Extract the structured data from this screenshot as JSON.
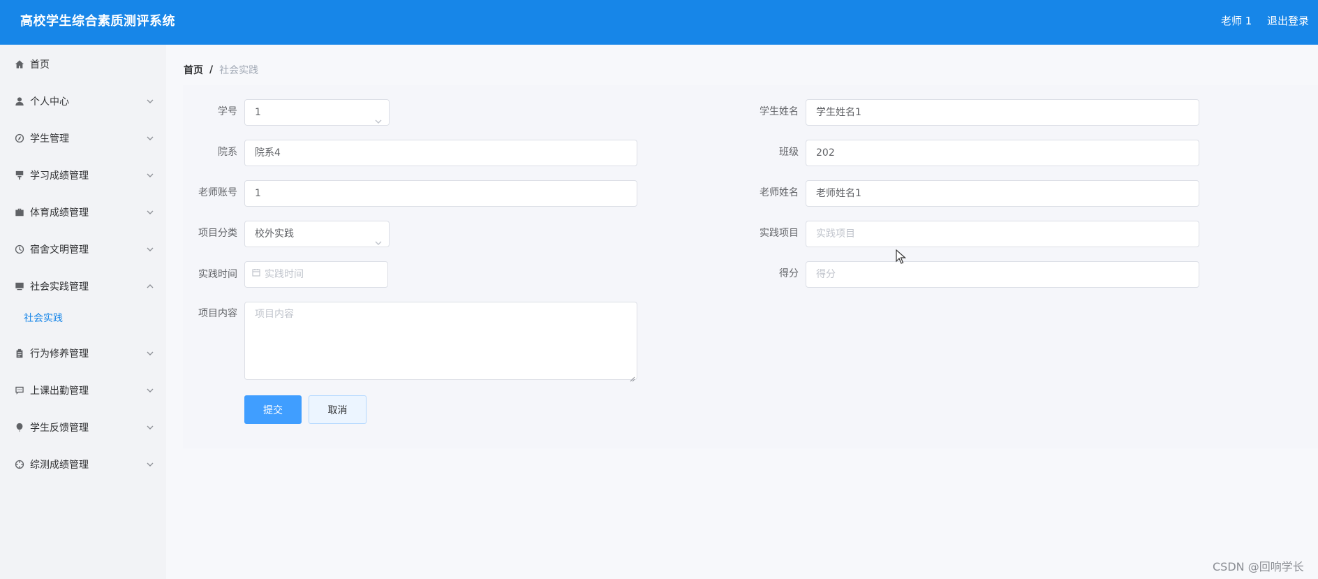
{
  "header": {
    "title": "高校学生综合素质测评系统",
    "user": "老师 1",
    "logout": "退出登录"
  },
  "sidebar": {
    "items": [
      {
        "label": "首页",
        "icon": "home-icon",
        "arrow": false
      },
      {
        "label": "个人中心",
        "icon": "user-icon",
        "arrow": "down"
      },
      {
        "label": "学生管理",
        "icon": "compass-icon",
        "arrow": "down"
      },
      {
        "label": "学习成绩管理",
        "icon": "brush-icon",
        "arrow": "down"
      },
      {
        "label": "体育成绩管理",
        "icon": "briefcase-icon",
        "arrow": "down"
      },
      {
        "label": "宿舍文明管理",
        "icon": "clock-icon",
        "arrow": "down"
      },
      {
        "label": "社会实践管理",
        "icon": "monitor-icon",
        "arrow": "up"
      },
      {
        "label": "行为修养管理",
        "icon": "clipboard-icon",
        "arrow": "down"
      },
      {
        "label": "上课出勤管理",
        "icon": "chat-icon",
        "arrow": "down"
      },
      {
        "label": "学生反馈管理",
        "icon": "balloon-icon",
        "arrow": "down"
      },
      {
        "label": "综测成绩管理",
        "icon": "crosshair-icon",
        "arrow": "down"
      }
    ],
    "subitem": "社会实践"
  },
  "breadcrumb": {
    "home": "首页",
    "separator": "/",
    "current": "社会实践"
  },
  "form": {
    "student_id": {
      "label": "学号",
      "value": "1"
    },
    "student_name": {
      "label": "学生姓名",
      "value": "学生姓名1"
    },
    "department": {
      "label": "院系",
      "value": "院系4"
    },
    "class": {
      "label": "班级",
      "value": "202"
    },
    "teacher_account": {
      "label": "老师账号",
      "value": "1"
    },
    "teacher_name": {
      "label": "老师姓名",
      "value": "老师姓名1"
    },
    "category": {
      "label": "项目分类",
      "value": "校外实践"
    },
    "project": {
      "label": "实践项目",
      "placeholder": "实践项目"
    },
    "time": {
      "label": "实践时间",
      "placeholder": "实践时间"
    },
    "score": {
      "label": "得分",
      "placeholder": "得分"
    },
    "content": {
      "label": "项目内容",
      "placeholder": "项目内容"
    }
  },
  "buttons": {
    "submit": "提交",
    "cancel": "取消"
  },
  "watermark": "CSDN @回响学长",
  "colors": {
    "header": "#1786e8",
    "primary": "#409eff",
    "active_sub": "#1786e8"
  }
}
